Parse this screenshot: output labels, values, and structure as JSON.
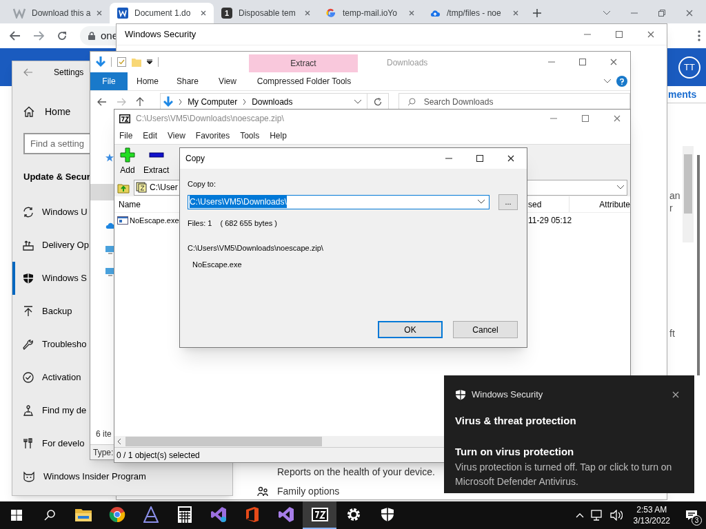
{
  "browser": {
    "tabs": [
      {
        "kind": "w",
        "title": "Download this a",
        "selected": false
      },
      {
        "kind": "word",
        "title": "Document 1.do",
        "selected": true
      },
      {
        "kind": "number",
        "icon_text": "1",
        "title": "Disposable tem",
        "selected": false
      },
      {
        "kind": "google",
        "title": "temp-mail.ioYo",
        "selected": false
      },
      {
        "kind": "cloud",
        "title": "/tmp/files - noe",
        "selected": false
      }
    ],
    "address": "one",
    "avatar": "TT",
    "link": "ments",
    "fragments": [
      "an",
      "r",
      "ft"
    ]
  },
  "security_window": {
    "title": "Windows Security",
    "items": [
      {
        "kind": "text",
        "label": "Reports on the health of your device."
      },
      {
        "kind": "family",
        "label": "Family options"
      }
    ]
  },
  "settings": {
    "title": "Settings",
    "home": "Home",
    "search_placeholder": "Find a setting",
    "section": "Update & Secur",
    "items": [
      {
        "kind": "update",
        "label": "Windows U",
        "selected": false
      },
      {
        "kind": "delivery",
        "label": "Delivery Op",
        "selected": false
      },
      {
        "kind": "security",
        "label": "Windows S",
        "selected": true
      },
      {
        "kind": "backup",
        "label": "Backup",
        "selected": false
      },
      {
        "kind": "troubleshoot",
        "label": "Troublesho",
        "selected": false
      },
      {
        "kind": "activation",
        "label": "Activation",
        "selected": false
      },
      {
        "kind": "find",
        "label": "Find my de",
        "selected": false
      },
      {
        "kind": "developer",
        "label": "For develo",
        "selected": false
      },
      {
        "kind": "insider",
        "label": "Windows Insider Program",
        "selected": false
      }
    ]
  },
  "explorer": {
    "context_tab": "Extract",
    "title": "Downloads",
    "ribbon_tabs": [
      {
        "kind": "file",
        "label": "File"
      },
      {
        "kind": "tab",
        "label": "Home"
      },
      {
        "kind": "tab",
        "label": "Share"
      },
      {
        "kind": "tab",
        "label": "View"
      },
      {
        "kind": "context",
        "label": "Compressed Folder Tools"
      }
    ],
    "breadcrumb": [
      "My Computer",
      "Downloads"
    ],
    "search_placeholder": "Search Downloads",
    "item_count": "6 ite",
    "status": "Type: "
  },
  "sevenzip": {
    "title": "C:\\Users\\VM5\\Downloads\\noescape.zip\\",
    "menu": [
      "File",
      "Edit",
      "View",
      "Favorites",
      "Tools",
      "Help"
    ],
    "toolbar": [
      {
        "kind": "add",
        "label": "Add"
      },
      {
        "kind": "extract",
        "label": "Extract"
      }
    ],
    "address": "C:\\User",
    "columns": [
      "Name",
      "sed",
      "Attribute"
    ],
    "rows": [
      {
        "name": "NoEscape.exe",
        "modified": "11-29 05:12"
      }
    ],
    "status": "0 / 1 object(s) selected"
  },
  "copy_dialog": {
    "title": "Copy",
    "label": "Copy to:",
    "value": "C:\\Users\\VM5\\Downloads\\",
    "browse": "...",
    "files": "Files: 1",
    "size": "( 682 655 bytes )",
    "path": "C:\\Users\\VM5\\Downloads\\noescape.zip\\",
    "item": "NoEscape.exe",
    "buttons": [
      {
        "label": "OK",
        "default": true
      },
      {
        "label": "Cancel",
        "default": false
      }
    ]
  },
  "toast": {
    "app": "Windows Security",
    "heading": "Virus & threat protection",
    "title": "Turn on virus protection",
    "body": "Virus protection is turned off. Tap or click to turn on Microsoft Defender Antivirus."
  },
  "taskbar": {
    "apps": [
      {
        "kind": "folder",
        "selected": false
      },
      {
        "kind": "chrome",
        "selected": false
      },
      {
        "kind": "a",
        "selected": false
      },
      {
        "kind": "calculator",
        "selected": false
      },
      {
        "kind": "vs-preview",
        "selected": false
      },
      {
        "kind": "office",
        "selected": false
      },
      {
        "kind": "vs",
        "selected": false
      },
      {
        "kind": "sevenzip",
        "selected": true
      },
      {
        "kind": "gear",
        "selected": false
      },
      {
        "kind": "shield",
        "selected": false
      }
    ],
    "time": "2:53 AM",
    "date": "3/13/2022",
    "notifications": "3"
  }
}
